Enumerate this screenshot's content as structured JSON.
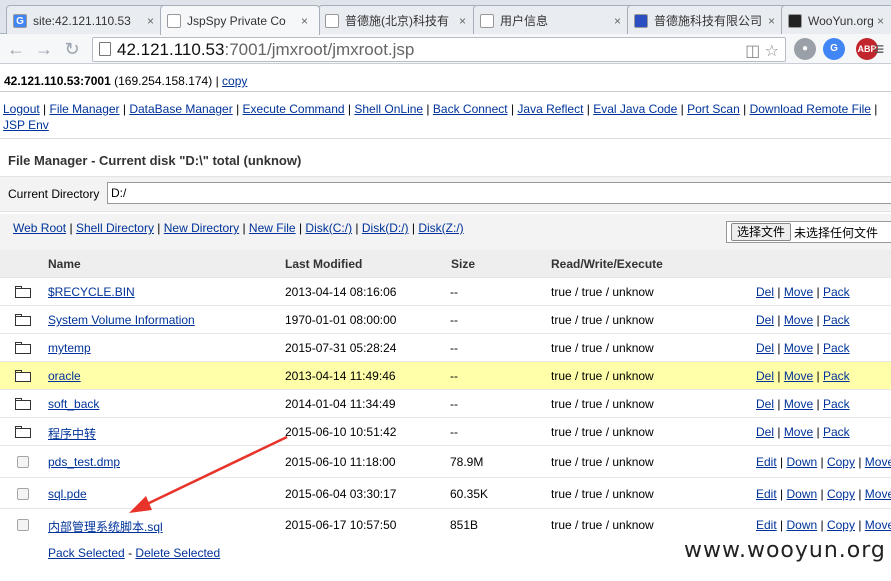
{
  "tabs": [
    {
      "label": "site:42.121.110.53",
      "favicon": "G",
      "color": "#4285f4"
    },
    {
      "label": "JspSpy Private Co",
      "favicon": "",
      "color": "#ffffff"
    },
    {
      "label": "普德施(北京)科技有",
      "favicon": "",
      "color": "#ffffff"
    },
    {
      "label": "用户信息",
      "favicon": "",
      "color": "#ffffff"
    },
    {
      "label": "普德施科技有限公司",
      "favicon": "",
      "color": "#2b4fc0"
    },
    {
      "label": "WooYun.org",
      "favicon": "",
      "color": "#222"
    }
  ],
  "address": {
    "host": "42.121.110.53",
    "path": ":7001/jmxroot/jmxroot.jsp"
  },
  "extensions": {
    "abp": "ABP"
  },
  "hostline": {
    "server": "42.121.110.53:7001",
    "ip": "(169.254.158.174)",
    "sep": "|",
    "copy": "copy"
  },
  "menu": [
    "Logout",
    "File Manager",
    "DataBase Manager",
    "Execute Command",
    "Shell OnLine",
    "Back Connect",
    "Java Reflect",
    "Eval Java Code",
    "Port Scan",
    "Download Remote File",
    "JSP Env"
  ],
  "file_manager": {
    "title": "File Manager - Current disk \"D:\\\" total (unknow)",
    "current_dir_label": "Current Directory",
    "current_dir_value": "D:/",
    "quick_links": [
      "Web Root",
      "Shell Directory",
      "New Directory",
      "New File",
      "Disk(C:/)",
      "Disk(D:/)",
      "Disk(Z:/)"
    ],
    "upload_button": "选择文件",
    "upload_status": "未选择任何文件",
    "columns": {
      "name": "Name",
      "modified": "Last Modified",
      "size": "Size",
      "rwe": "Read/Write/Execute"
    },
    "rows": [
      {
        "type": "dir",
        "name": "$RECYCLE.BIN",
        "modified": "2013-04-14 08:16:06",
        "size": "--",
        "rwe": "true / true / unknow",
        "actions": [
          "Del",
          "Move",
          "Pack"
        ]
      },
      {
        "type": "dir",
        "name": "System Volume Information",
        "modified": "1970-01-01 08:00:00",
        "size": "--",
        "rwe": "true / true / unknow",
        "actions": [
          "Del",
          "Move",
          "Pack"
        ]
      },
      {
        "type": "dir",
        "name": "mytemp",
        "modified": "2015-07-31 05:28:24",
        "size": "--",
        "rwe": "true / true / unknow",
        "actions": [
          "Del",
          "Move",
          "Pack"
        ]
      },
      {
        "type": "dir",
        "name": "oracle",
        "modified": "2013-04-14 11:49:46",
        "size": "--",
        "rwe": "true / true / unknow",
        "actions": [
          "Del",
          "Move",
          "Pack"
        ],
        "highlight": true
      },
      {
        "type": "dir",
        "name": "soft_back",
        "modified": "2014-01-04 11:34:49",
        "size": "--",
        "rwe": "true / true / unknow",
        "actions": [
          "Del",
          "Move",
          "Pack"
        ]
      },
      {
        "type": "dir",
        "name": "程序中转",
        "modified": "2015-06-10 10:51:42",
        "size": "--",
        "rwe": "true / true / unknow",
        "actions": [
          "Del",
          "Move",
          "Pack"
        ]
      },
      {
        "type": "file",
        "name": "pds_test.dmp",
        "modified": "2015-06-10 11:18:00",
        "size": "78.9M",
        "rwe": "true / true / unknow",
        "actions": [
          "Edit",
          "Down",
          "Copy",
          "Move"
        ]
      },
      {
        "type": "file",
        "name": "sql.pde",
        "modified": "2015-06-04 03:30:17",
        "size": "60.35K",
        "rwe": "true / true / unknow",
        "actions": [
          "Edit",
          "Down",
          "Copy",
          "Move"
        ]
      },
      {
        "type": "file",
        "name": "内部管理系统脚本.sql",
        "modified": "2015-06-17 10:57:50",
        "size": "851B",
        "rwe": "true / true / unknow",
        "actions": [
          "Edit",
          "Down",
          "Copy",
          "Move"
        ]
      }
    ],
    "pack_selected": "Pack Selected",
    "dash": "-",
    "delete_selected": "Delete Selected"
  },
  "watermark": "www.wooyun.org",
  "colors": {
    "link": "#003399",
    "highlight_row": "#ffffaa",
    "arrow": "#e8332a"
  }
}
